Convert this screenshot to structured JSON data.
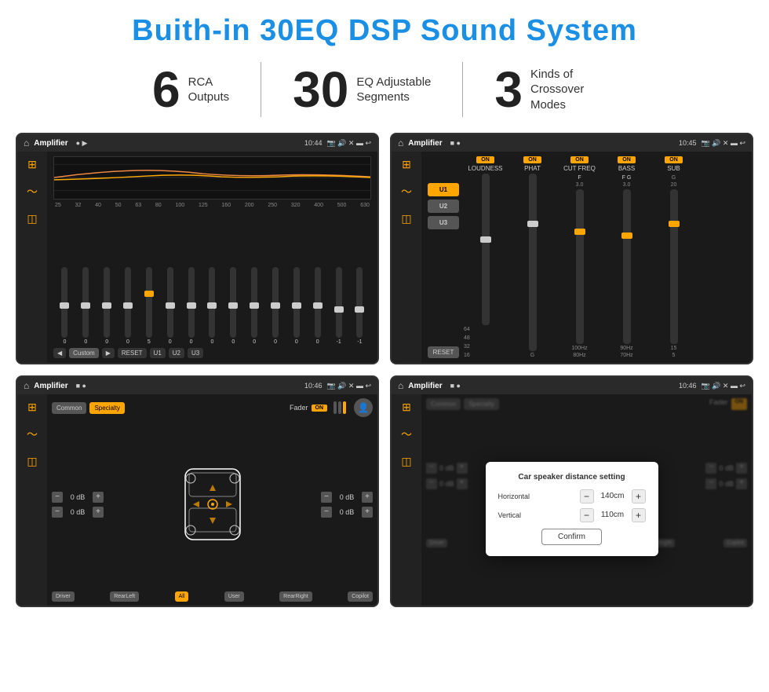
{
  "page": {
    "title": "Buith-in 30EQ DSP Sound System",
    "stats": [
      {
        "number": "6",
        "label": "RCA\nOutputs"
      },
      {
        "number": "30",
        "label": "EQ Adjustable\nSegments"
      },
      {
        "number": "3",
        "label": "Kinds of\nCrossover Modes"
      }
    ],
    "screens": [
      {
        "id": "eq-screen",
        "status_bar": {
          "app": "Amplifier",
          "time": "10:44"
        },
        "type": "eq"
      },
      {
        "id": "crossover-screen",
        "status_bar": {
          "app": "Amplifier",
          "time": "10:45"
        },
        "type": "crossover"
      },
      {
        "id": "fader-screen",
        "status_bar": {
          "app": "Amplifier",
          "time": "10:46"
        },
        "type": "fader"
      },
      {
        "id": "dialog-screen",
        "status_bar": {
          "app": "Amplifier",
          "time": "10:46"
        },
        "type": "dialog"
      }
    ]
  },
  "ui": {
    "eq": {
      "frequencies": [
        "25",
        "32",
        "40",
        "50",
        "63",
        "80",
        "100",
        "125",
        "160",
        "200",
        "250",
        "320",
        "400",
        "500",
        "630"
      ],
      "values": [
        "0",
        "0",
        "0",
        "0",
        "5",
        "0",
        "0",
        "0",
        "0",
        "0",
        "0",
        "0",
        "0",
        "-1",
        "0",
        "-1"
      ],
      "buttons": [
        "Custom",
        "RESET",
        "U1",
        "U2",
        "U3"
      ]
    },
    "crossover": {
      "presets": [
        "U1",
        "U2",
        "U3"
      ],
      "channels": [
        {
          "name": "LOUDNESS",
          "on": true
        },
        {
          "name": "PHAT",
          "on": true
        },
        {
          "name": "CUT FREQ",
          "on": true
        },
        {
          "name": "BASS",
          "on": true
        },
        {
          "name": "SUB",
          "on": true
        }
      ],
      "reset_label": "RESET"
    },
    "fader": {
      "tabs": [
        "Common",
        "Specialty"
      ],
      "active_tab": "Specialty",
      "fader_label": "Fader",
      "fader_on": "ON",
      "left_db": "0 dB",
      "right_db": "0 dB",
      "left_db2": "0 dB",
      "right_db2": "0 dB",
      "zones": [
        "Driver",
        "RearLeft",
        "All",
        "User",
        "RearRight",
        "Copilot"
      ]
    },
    "dialog": {
      "title": "Car speaker distance setting",
      "horizontal_label": "Horizontal",
      "horizontal_value": "140cm",
      "vertical_label": "Vertical",
      "vertical_value": "110cm",
      "confirm_label": "Confirm",
      "right_db1": "0 dB",
      "right_db2": "0 dB"
    }
  }
}
